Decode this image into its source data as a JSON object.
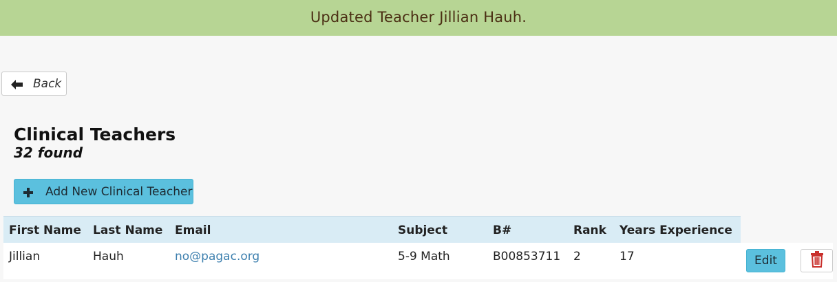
{
  "flash": {
    "message": "Updated Teacher Jillian Hauh.",
    "color": "#b7d594"
  },
  "back_button": {
    "label": "Back",
    "icon": "arrow-left-icon"
  },
  "page": {
    "title": "Clinical Teachers",
    "count_text": "32 found"
  },
  "add_button": {
    "label": "Add New Clinical Teacher",
    "icon": "plus-icon",
    "color": "#5bc0de"
  },
  "table": {
    "headers": [
      "First Name",
      "Last Name",
      "Email",
      "Subject",
      "B#",
      "Rank",
      "Years Experience"
    ],
    "rows": [
      {
        "first_name": "Jillian",
        "last_name": "Hauh",
        "email": "no@pagac.org",
        "subject": "5-9 Math",
        "b_number": "B00853711",
        "rank": "2",
        "years_experience": "17",
        "edit_label": "Edit",
        "delete_icon": "trash-icon"
      }
    ]
  },
  "colors": {
    "link": "#3c7fae",
    "header_bg": "#d9ecf5",
    "delete_icon": "#c9302c"
  }
}
